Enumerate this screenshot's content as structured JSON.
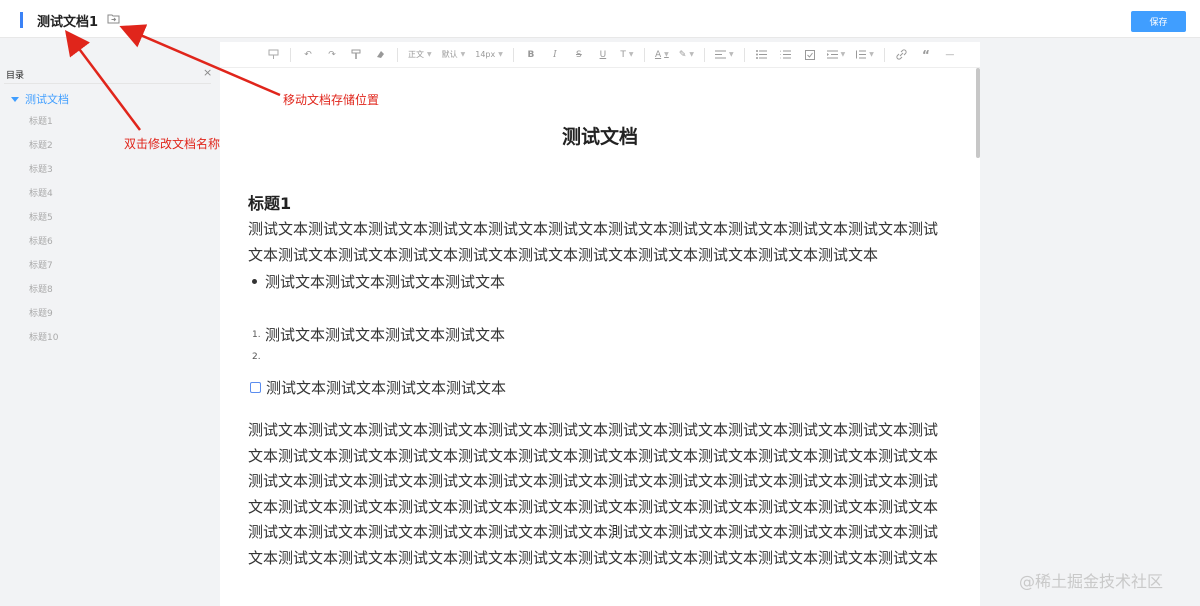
{
  "header": {
    "title": "测试文档1",
    "save_label": "保存",
    "move_icon": "folder-move-icon"
  },
  "sidebar": {
    "heading": "目录",
    "close_glyph": "×",
    "root": "测试文档",
    "items": [
      "标题1",
      "标题2",
      "标题3",
      "标题4",
      "标题5",
      "标题6",
      "标题7",
      "标题8",
      "标题9",
      "标题10"
    ]
  },
  "toolbar": {
    "paragraph": "正文",
    "font": "默认",
    "size": "14px"
  },
  "document": {
    "title": "测试文档",
    "heading1": "标题1",
    "paragraph1": "测试文本测试文本测试文本测试文本测试文本测试文本测试文本测试文本测试文本测试文本测试文本测试文本测试文本测试文本测试文本测试文本测试文本测试文本测试文本测试文本测试文本测试文本",
    "bullet_item": "测试文本测试文本测试文本测试文本",
    "ordered_items": [
      "测试文本测试文本测试文本测试文本",
      ""
    ],
    "ordered_numbers": [
      "1.",
      "2."
    ],
    "task_item": "测试文本测试文本测试文本测试文本",
    "paragraph2": "测试文本测试文本测试文本测试文本测试文本测试文本测试文本测试文本测试文本测试文本测试文本测试文本测试文本测试文本测试文本测试文本测试文本测试文本测试文本测试文本测试文本测试文本测试文本测试文本测试文本测试文本测试文本测试文本测试文本测试文本测试文本测试文本测试文本测试文本测试文本测试文本测试文本测试文本测试文本测试文本测试文本测试文本测试文本测试文本测试文本测试文本测试文本测试文本测试文本测试文本测试文本测试文本測试文本测试文本测试文本测试文本测试文本测试文本测试文本测试文本测试文本测试文本测试文本测试文本测试文本测试文本测试文本测试文本测试文本"
  },
  "annotations": {
    "move_location": "移动文档存储位置",
    "rename": "双击修改文档名称",
    "color": "#e0251b"
  },
  "watermark": "@稀土掘金技术社区",
  "colors": {
    "accent": "#409eff",
    "header_accent": "#3b82f6"
  }
}
